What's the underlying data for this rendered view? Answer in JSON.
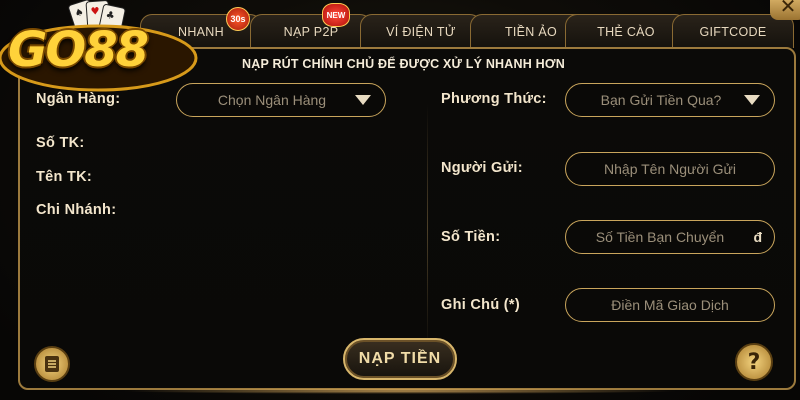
{
  "logo": {
    "text": "GO88"
  },
  "tabs": [
    {
      "label": "NHANH",
      "badge": "30s"
    },
    {
      "label": "NẠP P2P",
      "badge": "NEW"
    },
    {
      "label": "VÍ ĐIỆN TỬ"
    },
    {
      "label": "TIỀN ẢO"
    },
    {
      "label": "THẺ CÀO"
    },
    {
      "label": "GIFTCODE"
    }
  ],
  "close": {
    "label": "✕"
  },
  "notice": "NẠP RÚT CHÍNH CHỦ ĐỂ ĐƯỢC XỬ LÝ NHANH HƠN",
  "left": {
    "bank_label": "Ngân Hàng:",
    "bank_select": "Chọn Ngân Hàng",
    "account_no_label": "Số TK:",
    "account_name_label": "Tên TK:",
    "branch_label": "Chi Nhánh:"
  },
  "right": {
    "method_label": "Phương Thức:",
    "method_select": "Bạn Gửi Tiền Qua?",
    "sender_label": "Người Gửi:",
    "sender_placeholder": "Nhập Tên Người Gửi",
    "amount_label": "Số Tiền:",
    "amount_placeholder": "Số Tiền Bạn Chuyển",
    "amount_currency": "đ",
    "note_label": "Ghi Chú (*)",
    "note_placeholder": "Điền Mã Giao Dịch"
  },
  "submit_label": "NẠP TIỀN",
  "help_label": "?",
  "colors": {
    "gold": "#c9a55c",
    "panel_bg": "#0a0907",
    "text": "#f3e6cc"
  }
}
